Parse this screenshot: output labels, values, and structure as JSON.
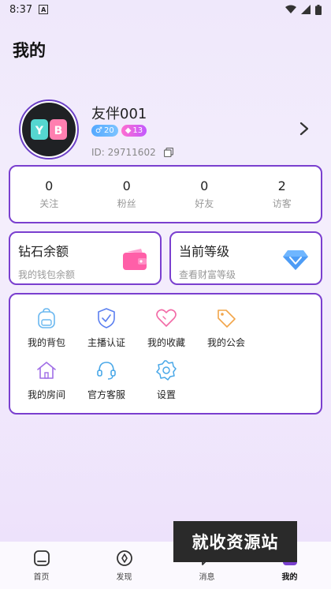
{
  "status_bar": {
    "time": "8:37",
    "notif_letter": "A"
  },
  "page_title": "我的",
  "profile": {
    "nickname": "友伴001",
    "gender_badge": "20",
    "level_badge": "13",
    "uid": "ID: 29711602",
    "avatar_text": "YB"
  },
  "stats": [
    {
      "value": "0",
      "label": "关注"
    },
    {
      "value": "0",
      "label": "粉丝"
    },
    {
      "value": "0",
      "label": "好友"
    },
    {
      "value": "2",
      "label": "访客"
    }
  ],
  "wallet": {
    "title": "钻石余额",
    "subtitle": "我的钱包余额"
  },
  "level": {
    "title": "当前等级",
    "subtitle": "查看财富等级"
  },
  "menu": [
    {
      "label": "我的背包",
      "icon": "backpack-icon"
    },
    {
      "label": "主播认证",
      "icon": "shield-check-icon"
    },
    {
      "label": "我的收藏",
      "icon": "heart-icon"
    },
    {
      "label": "我的公会",
      "icon": "tag-icon"
    },
    {
      "label": "我的房间",
      "icon": "home-icon"
    },
    {
      "label": "官方客服",
      "icon": "headset-icon"
    },
    {
      "label": "设置",
      "icon": "gear-icon"
    }
  ],
  "watermark": "就收资源站",
  "tabs": [
    {
      "label": "首页"
    },
    {
      "label": "发现"
    },
    {
      "label": "消息"
    },
    {
      "label": "我的"
    }
  ],
  "colors": {
    "accent": "#7a3fcf",
    "background": "#efe8fb"
  }
}
